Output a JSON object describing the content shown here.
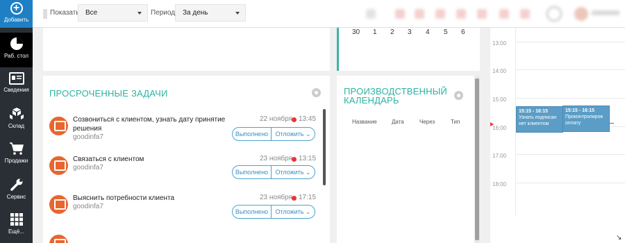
{
  "sidebar": {
    "add_label": "Добавить",
    "items": [
      {
        "label": "Раб. стол",
        "icon": "pie-chart-icon",
        "active": true
      },
      {
        "label": "Сведения",
        "icon": "id-card-icon",
        "active": false
      },
      {
        "label": "Склад",
        "icon": "boxes-icon",
        "active": false
      },
      {
        "label": "Продажи",
        "icon": "cart-icon",
        "active": false
      },
      {
        "label": "Сервис",
        "icon": "wrench-icon",
        "active": false
      },
      {
        "label": "Ещё...",
        "icon": "grid-icon",
        "active": false
      }
    ]
  },
  "topbar": {
    "show_label": "Показать",
    "show_value": "Все",
    "period_label": "Период",
    "period_value": "За день"
  },
  "mini_calendar": {
    "days": [
      "30",
      "1",
      "2",
      "3",
      "4",
      "5",
      "6"
    ]
  },
  "overdue": {
    "title": "ПРОСРОЧЕННЫЕ ЗАДАЧИ",
    "done_label": "Выполнено",
    "defer_label": "Отложить",
    "tasks": [
      {
        "title": "Созвониться с клиентом, узнать дату принятие решения",
        "user": "goodinfa7",
        "date": "22 ноября",
        "time": "13:45"
      },
      {
        "title": "Связаться с клиентом",
        "user": "goodinfa7",
        "date": "23 ноября",
        "time": "13:15"
      },
      {
        "title": "Выяснить потребности клиента",
        "user": "goodinfa7",
        "date": "23 ноября",
        "time": "17:15"
      }
    ]
  },
  "prod_calendar": {
    "title_line1": "ПРОИЗВОДСТВЕННЫЙ",
    "title_line2": "КАЛЕНДАРЬ",
    "columns": [
      "Название",
      "Дата",
      "Через",
      "Тип"
    ]
  },
  "schedule": {
    "hours": [
      "13:00",
      "14:00",
      "15:00",
      "16:00",
      "17:00",
      "18:00"
    ],
    "events": [
      {
        "time": "15:15 - 16:15",
        "title": "Узнать подписан нет клиентом"
      },
      {
        "time": "15:15 - 16:15",
        "title": "Проконтролиров оплату"
      }
    ]
  },
  "colors": {
    "accent": "#2ab3a3",
    "brand_blue": "#1e7fc4",
    "sidebar_bg": "#2a2f35",
    "task_icon": "#e8662f",
    "event": "#5b9dc6"
  }
}
